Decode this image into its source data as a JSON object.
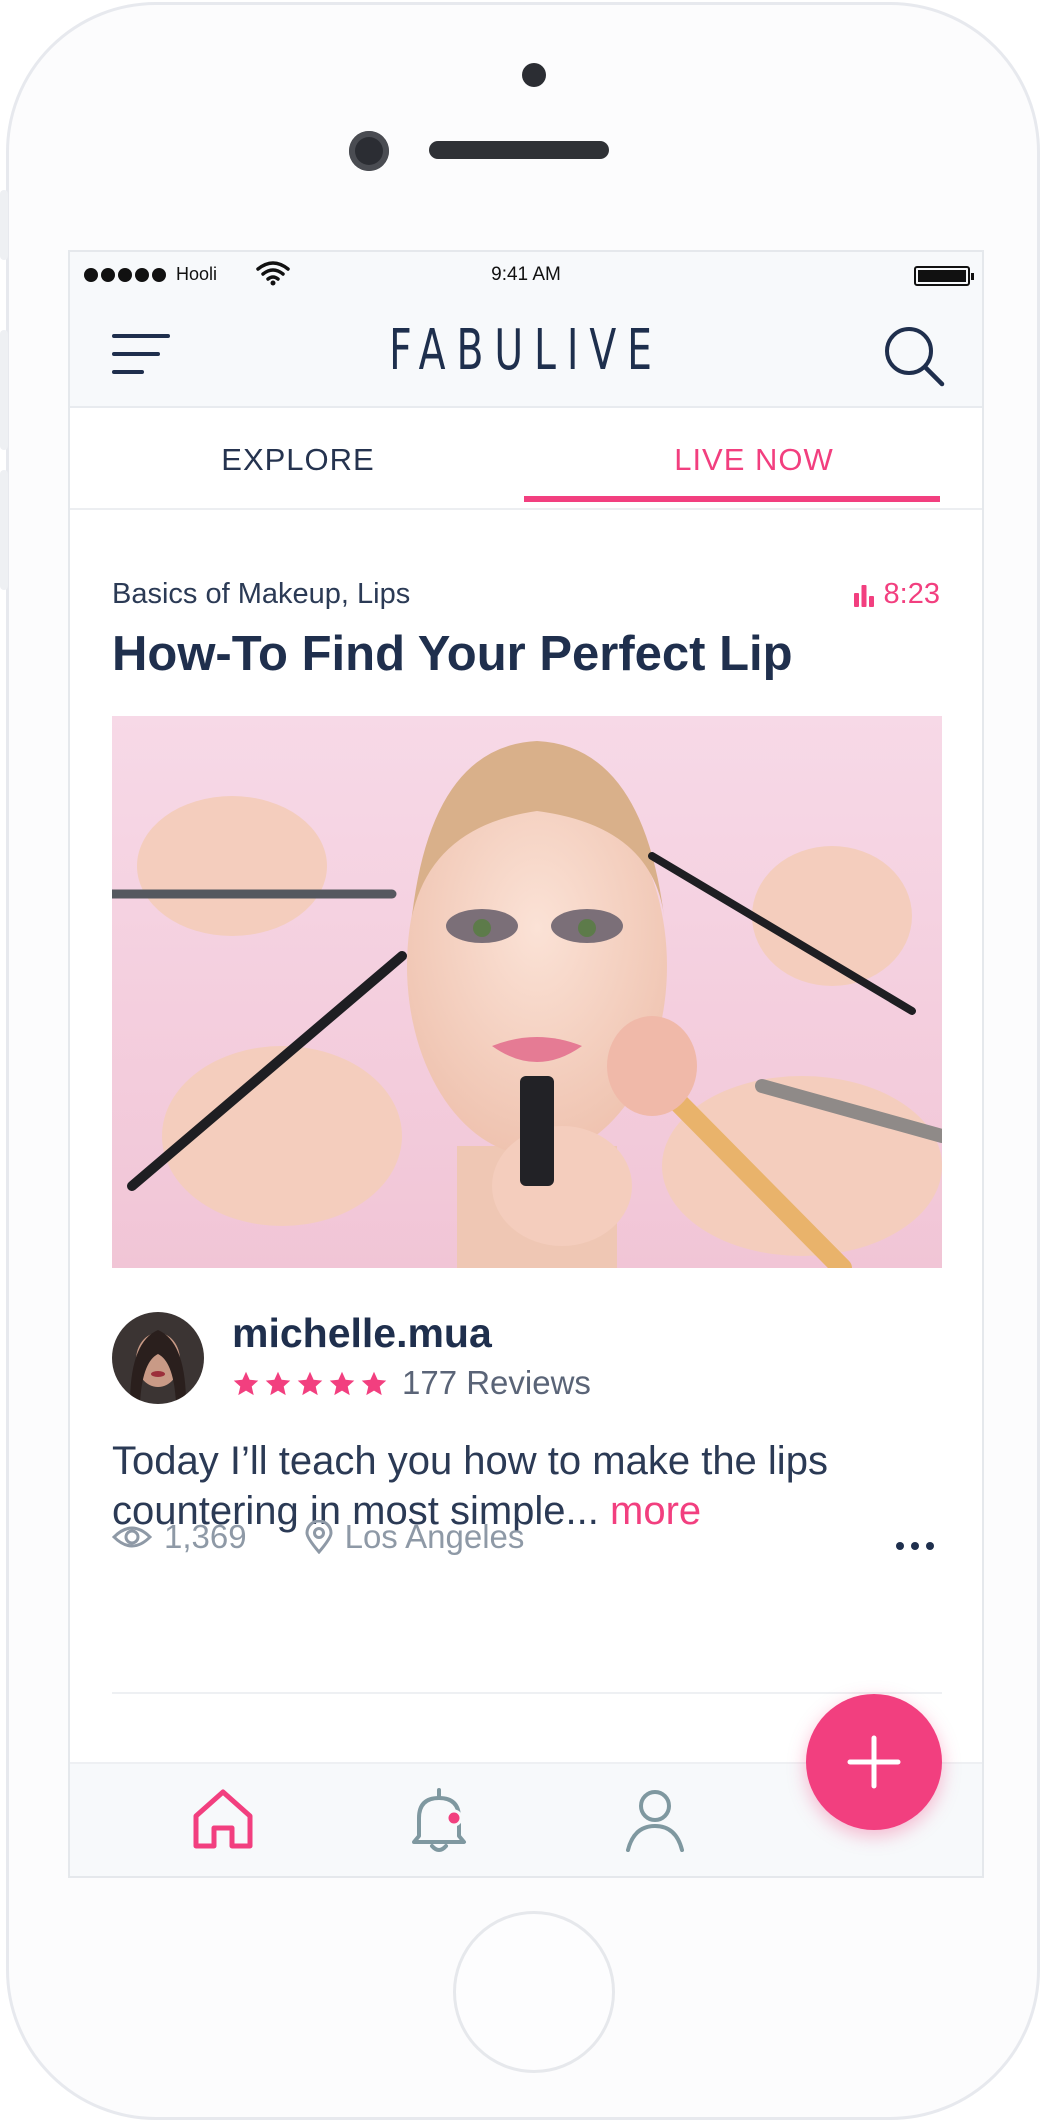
{
  "status_bar": {
    "carrier": "Hooli",
    "time": "9:41 AM"
  },
  "header": {
    "logo": "FABULIVE"
  },
  "tabs": [
    {
      "label": "EXPLORE",
      "active": false
    },
    {
      "label": "LIVE NOW",
      "active": true
    }
  ],
  "card": {
    "category": "Basics of Makeup, Lips",
    "live_duration": "8:23",
    "title": "How-To Find Your Perfect Lip",
    "author": "michelle.mua",
    "rating": 5,
    "reviews": "177 Reviews",
    "description": "Today I’ll teach you how to make the lips countering in most simple...",
    "more_label": "more",
    "views": "1,369",
    "location": "Los Angeles"
  },
  "bottom_nav": [
    {
      "icon": "home-icon",
      "active": true
    },
    {
      "icon": "bell-icon",
      "has_notification": true
    },
    {
      "icon": "profile-icon"
    }
  ],
  "colors": {
    "accent": "#f23f7f",
    "navy": "#1f2f4d",
    "muted": "#8e99a6",
    "bar_bg": "#f7f9fb"
  }
}
